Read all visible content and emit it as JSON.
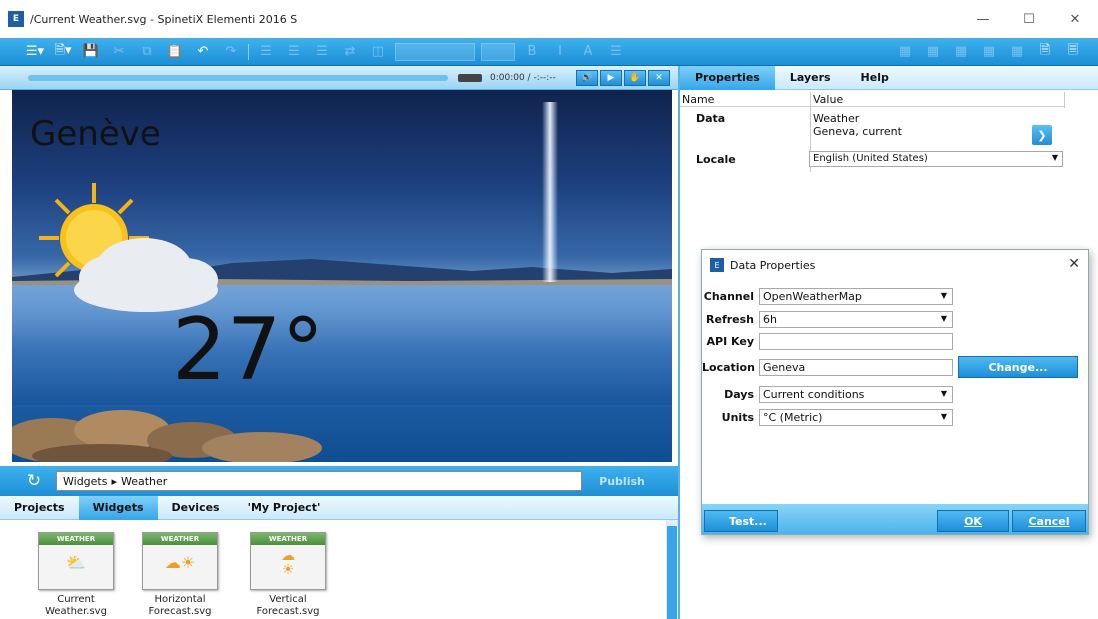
{
  "window": {
    "title": "/Current Weather.svg - SpinetiX Elementi 2016 S",
    "app_icon_text": "E"
  },
  "player": {
    "timecode": "0:00:00 / -:--:--"
  },
  "preview": {
    "city": "Genève",
    "temperature": "27°"
  },
  "breadcrumb": {
    "path": [
      "Widgets",
      "Weather"
    ],
    "separator": "▸",
    "publish_label": "Publish"
  },
  "bottom_tabs": [
    "Projects",
    "Widgets",
    "Devices",
    "'My Project'"
  ],
  "bottom_active_tab": "Widgets",
  "widgets": [
    {
      "header": "WEATHER",
      "label_line1": "Current",
      "label_line2": "Weather.svg"
    },
    {
      "header": "WEATHER",
      "label_line1": "Horizontal",
      "label_line2": "Forecast.svg"
    },
    {
      "header": "WEATHER",
      "label_line1": "Vertical Forecast.svg",
      "label_line2": ""
    }
  ],
  "right_tabs": [
    "Properties",
    "Layers",
    "Help"
  ],
  "right_active_tab": "Properties",
  "properties": {
    "col_name": "Name",
    "col_value": "Value",
    "data_name": "Data",
    "data_value_line1": "Weather",
    "data_value_line2": "Geneva, current",
    "locale_name": "Locale",
    "locale_value": "English (United States)"
  },
  "dialog": {
    "title": "Data Properties",
    "fields": {
      "channel_label": "Channel",
      "channel_value": "OpenWeatherMap",
      "refresh_label": "Refresh",
      "refresh_value": "6h",
      "apikey_label": "API Key",
      "apikey_value": "",
      "location_label": "Location",
      "location_value": "Geneva",
      "days_label": "Days",
      "days_value": "Current conditions",
      "units_label": "Units",
      "units_value": "°C (Metric)"
    },
    "change_label": "Change...",
    "test_label": "Test...",
    "ok_label": "OK",
    "cancel_label": "Cancel"
  },
  "colors": {
    "accent": "#1c8fd6",
    "accent_light": "#7fd0f9"
  }
}
